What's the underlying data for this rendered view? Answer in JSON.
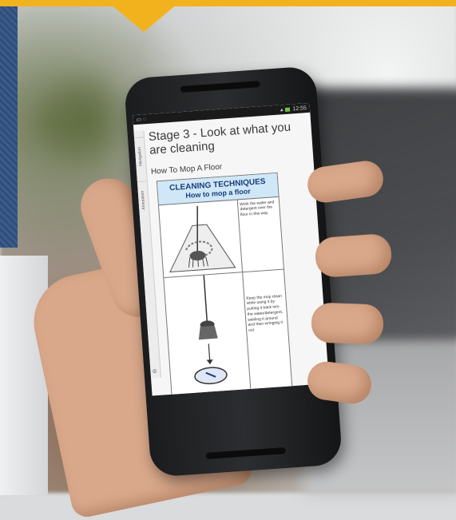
{
  "banner": {
    "color": "#f2b21e"
  },
  "phone": {
    "status_bar": {
      "time": "12:55"
    },
    "side_tabs": [
      "Navigation",
      "Annotation"
    ],
    "stage_title": "Stage 3 - Look at what you are cleaning",
    "section_title": "How To Mop A Floor",
    "technique": {
      "heading": "CLEANING TECHNIQUES",
      "subheading": "How to mop a floor",
      "steps": [
        {
          "text": "Work the water and detergent over the floor in this way"
        },
        {
          "text": "Keep the mop clean while using it by putting it back into the water/detergent, swirling it around and then wringing it out"
        }
      ]
    }
  }
}
